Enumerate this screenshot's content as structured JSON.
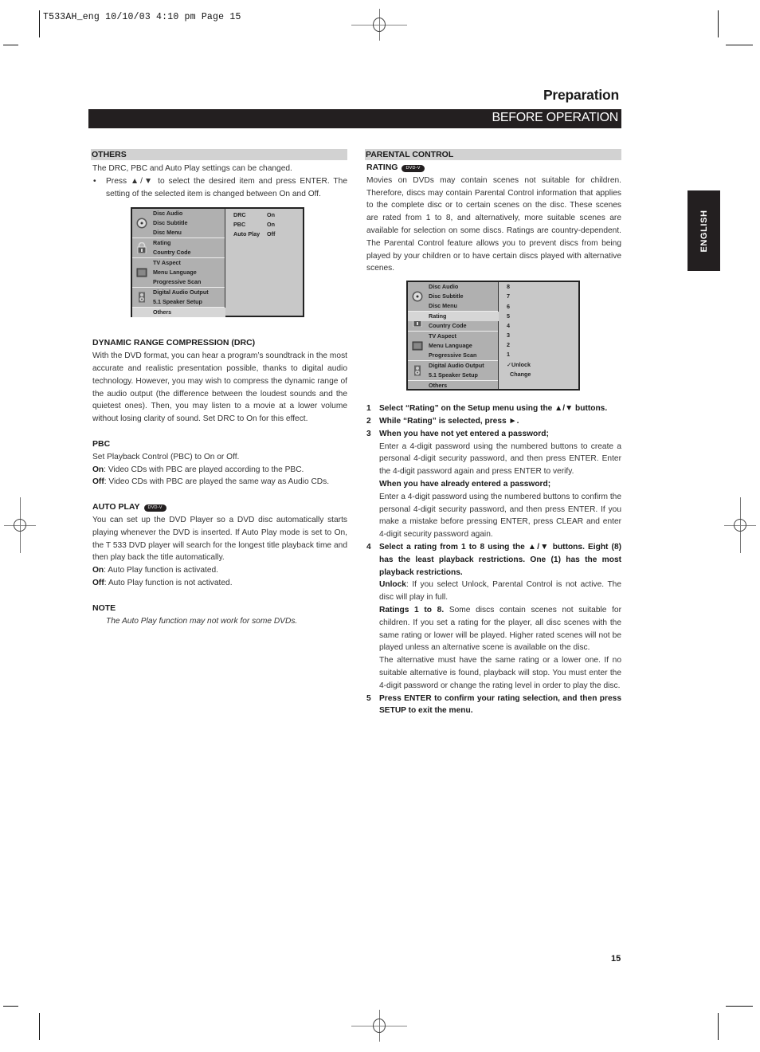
{
  "slug": "T533AH_eng  10/10/03  4:10 pm  Page 15",
  "header": {
    "section_title": "Preparation",
    "bar_title": "BEFORE OPERATION",
    "language_tab": "ENGLISH"
  },
  "left": {
    "others": {
      "heading": "OTHERS",
      "intro": "The DRC, PBC and Auto Play settings can be changed.",
      "bullet": "Press ▲/▼ to select the desired item and press ENTER. The setting of the selected item is changed between On and Off."
    },
    "osd_others": {
      "groups": [
        {
          "icon": "disc-icon",
          "items": [
            "Disc Audio",
            "Disc Subtitle",
            "Disc Menu"
          ]
        },
        {
          "icon": "lock-icon",
          "items": [
            "Rating",
            "Country Code"
          ]
        },
        {
          "icon": "tv-icon",
          "items": [
            "TV Aspect",
            "Menu Language",
            "Progressive Scan"
          ]
        },
        {
          "icon": "speaker-icon",
          "items": [
            "Digital Audio Output",
            "5.1 Speaker Setup"
          ]
        },
        {
          "icon": "",
          "items": [
            "Others"
          ]
        }
      ],
      "selected": "Others",
      "options": [
        {
          "label": "DRC",
          "value": "On"
        },
        {
          "label": "PBC",
          "value": "On"
        },
        {
          "label": "Auto Play",
          "value": "Off"
        }
      ]
    },
    "drc": {
      "heading": "DYNAMIC RANGE COMPRESSION (DRC)",
      "body": "With the DVD format, you can hear a program’s soundtrack in the most accurate and realistic presentation possible, thanks to digital audio technology. However, you may wish to compress the dynamic range of the audio output (the difference between the loudest sounds and the quietest ones). Then, you may listen to a movie at a lower volume without losing clarity of sound. Set DRC to On for this effect."
    },
    "pbc": {
      "heading": "PBC",
      "intro": "Set Playback Control (PBC) to On or Off.",
      "on_label": "On",
      "on_text": ": Video CDs with PBC are played according to the PBC.",
      "off_label": "Off",
      "off_text": ": Video CDs with PBC are played the same way as Audio CDs."
    },
    "autoplay": {
      "heading": "AUTO PLAY",
      "badge": "DVD-V",
      "body": "You can set up the DVD Player so a DVD disc automatically starts playing whenever the DVD is inserted. If Auto Play mode is set to On, the T 533 DVD player will search for the longest title playback time and then play back the title automatically.",
      "on_label": "On",
      "on_text": ": Auto Play function is activated.",
      "off_label": "Off",
      "off_text": ": Auto Play function is not activated."
    },
    "note": {
      "heading": "NOTE",
      "text": "The Auto Play function may not work for some DVDs."
    }
  },
  "right": {
    "parental": {
      "heading": "PARENTAL CONTROL",
      "sub_heading": "RATING",
      "badge": "DVD-V",
      "body": "Movies on DVDs may contain scenes not suitable for children. Therefore, discs may contain Parental Control information that applies to the complete disc or to certain scenes on the disc. These scenes are rated from 1 to 8, and alternatively, more suitable scenes are available for selection on some discs. Ratings are country-dependent. The Parental Control feature allows you to prevent discs from being played by your children or to have certain discs played with alternative scenes."
    },
    "osd_rating": {
      "groups": [
        {
          "icon": "disc-icon",
          "items": [
            "Disc Audio",
            "Disc Subtitle",
            "Disc Menu"
          ]
        },
        {
          "icon": "lock-icon",
          "items": [
            "Rating",
            "Country Code"
          ]
        },
        {
          "icon": "tv-icon",
          "items": [
            "TV Aspect",
            "Menu Language",
            "Progressive Scan"
          ]
        },
        {
          "icon": "speaker-icon",
          "items": [
            "Digital Audio Output",
            "5.1 Speaker Setup"
          ]
        },
        {
          "icon": "",
          "items": [
            "Others"
          ]
        }
      ],
      "selected": "Rating",
      "options": [
        "8",
        "7",
        "6",
        "5",
        "4",
        "3",
        "2",
        "1",
        "✓Unlock",
        "Change"
      ]
    },
    "steps": [
      {
        "num": "1",
        "lead": "Select “Rating” on the Setup menu using the ▲/▼ buttons.",
        "paras": []
      },
      {
        "num": "2",
        "lead": "While “Rating” is selected, press ►.",
        "paras": []
      },
      {
        "num": "3",
        "lead": "When you have not yet entered a password;",
        "paras": [
          {
            "text": "Enter a 4-digit password using the numbered buttons to create a personal 4-digit security password, and then press ENTER. Enter the 4-digit password again and press ENTER to verify."
          },
          {
            "bold": "When you have already entered a password;"
          },
          {
            "text": "Enter a 4-digit password using the numbered buttons to confirm the personal 4-digit security password, and then press ENTER. If you make a mistake before pressing ENTER, press CLEAR and enter 4-digit security password again."
          }
        ]
      },
      {
        "num": "4",
        "lead": "Select a rating from 1 to 8 using the ▲/▼ buttons. Eight (8) has the least playback restrictions. One (1) has the most playback restrictions.",
        "paras": [
          {
            "label": "Unlock",
            "text": ": If you select Unlock, Parental Control is not active. The disc will play in full."
          },
          {
            "label": "Ratings 1 to 8.",
            "text": " Some discs contain scenes not suitable for children. If you set a rating for the player, all disc scenes with the same rating or lower will be played. Higher rated scenes will not be played unless an alternative scene is available on the disc."
          },
          {
            "text": "The alternative must have the same rating or a lower one. If no suitable alternative is found, playback will stop. You must enter the 4-digit password or change the rating level in order to play the disc."
          }
        ]
      },
      {
        "num": "5",
        "lead": "Press ENTER to confirm your rating selection, and then press SETUP to exit the menu.",
        "paras": []
      }
    ]
  },
  "page_number": "15"
}
